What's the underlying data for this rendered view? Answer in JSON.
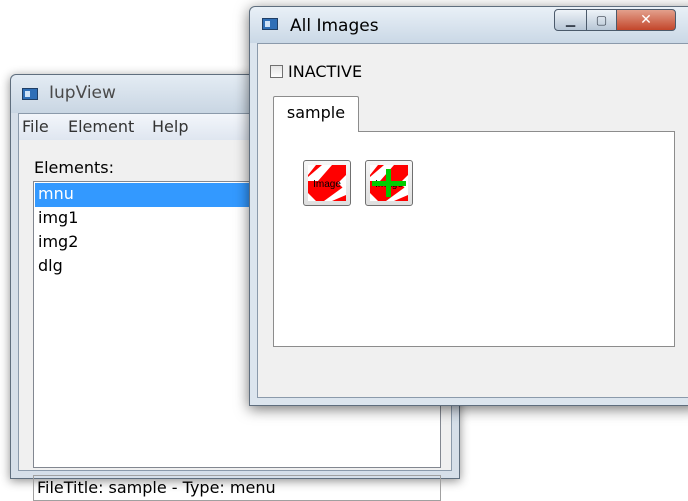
{
  "iupview": {
    "title": "IupView",
    "menu": [
      "File",
      "Element",
      "Help"
    ],
    "elements_label": "Elements:",
    "list_items": [
      "mnu",
      "img1",
      "img2",
      "dlg"
    ],
    "selected_index": 0,
    "status": "FileTitle: sample - Type: menu"
  },
  "all_images": {
    "title": "All Images",
    "caption_buttons": {
      "minimize": "▁",
      "maximize": "▢",
      "close": "✕"
    },
    "checkbox_label": "INACTIVE",
    "checkbox_checked": false,
    "tab_label": "sample",
    "images": [
      {
        "name": "img1",
        "icon": "image-icon",
        "text": "Image"
      },
      {
        "name": "img2",
        "icon": "image-cross-icon",
        "text": "Image"
      }
    ]
  },
  "colors": {
    "selection": "#3399ff",
    "image_red": "#ff0000",
    "image_green": "#00cc00"
  }
}
